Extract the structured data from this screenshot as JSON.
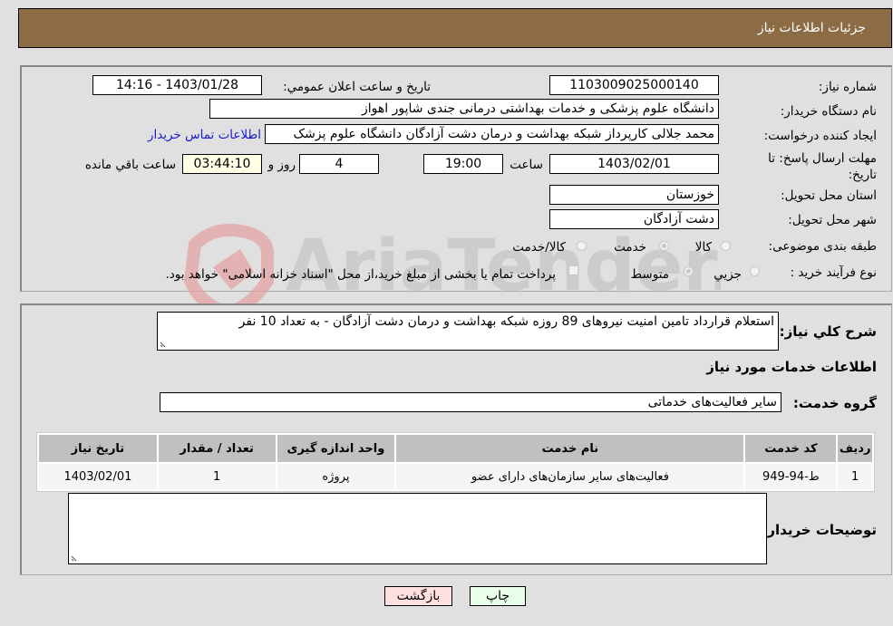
{
  "header": {
    "title": "جزئیات اطلاعات نیاز"
  },
  "form": {
    "need_number": {
      "label": "شماره نیاز:",
      "value": "1103009025000140"
    },
    "announce_datetime": {
      "label": "تاریخ و ساعت اعلان عمومي:",
      "value": "1403/01/28 - 14:16"
    },
    "buyer_org": {
      "label": "نام دستگاه خریدار:",
      "value": "دانشگاه علوم پزشکی و خدمات بهداشتی درمانی جندی شاپور اهواز"
    },
    "requester": {
      "label": "ایجاد کننده درخواست:",
      "value": "محمد جلالی کارپرداز شبکه بهداشت و درمان دشت آزادگان دانشگاه علوم پزشک",
      "contact_link": "اطلاعات تماس خریدار"
    },
    "deadline": {
      "label": "مهلت ارسال پاسخ: تا تاریخ:",
      "date": "1403/02/01",
      "time_label": "ساعت",
      "time": "19:00",
      "days": "4",
      "days_label": "روز و",
      "remaining": "03:44:10",
      "remaining_label": "ساعت باقي مانده"
    },
    "province": {
      "label": "استان محل تحویل:",
      "value": "خوزستان"
    },
    "city": {
      "label": "شهر محل تحویل:",
      "value": "دشت آزادگان"
    },
    "category": {
      "label": "طبقه بندی موضوعی:",
      "options": [
        "کالا",
        "خدمت",
        "کالا/خدمت"
      ],
      "selected": "خدمت"
    },
    "purchase_type": {
      "label": "نوع فرآیند خرید :",
      "options": [
        "جزيي",
        "متوسط"
      ],
      "selected": "متوسط",
      "treasury_note": "پرداخت تمام یا بخشی از مبلغ خرید،از محل \"اسناد خزانه اسلامی\" خواهد بود."
    }
  },
  "details": {
    "description_label": "شرح کلي نياز:",
    "description": "استعلام قرارداد تامین امنیت نیروهای 89 روزه  شبکه بهداشت و درمان دشت آزادگان   - به تعداد 10 نفر",
    "services_heading": "اطلاعات خدمات مورد نياز",
    "service_group_label": "گروه خدمت:",
    "service_group": "سایر فعالیت‌های خدماتی",
    "table": {
      "headers": [
        "ردیف",
        "کد خدمت",
        "نام خدمت",
        "واحد اندازه گیری",
        "تعداد / مقدار",
        "تاریخ نیاز"
      ],
      "rows": [
        [
          "1",
          "ط-94-949",
          "فعالیت‌های سایر سازمان‌های دارای عضو",
          "پروژه",
          "1",
          "1403/02/01"
        ]
      ]
    },
    "buyer_notes_label": "توضیحات خریدار:",
    "buyer_notes": ""
  },
  "buttons": {
    "print": "چاپ",
    "back": "بازگشت"
  },
  "watermark": {
    "text": "AriaTender.neT"
  },
  "colors": {
    "header_bg": "#8c6c44",
    "link": "#1a1acc",
    "print_bg": "#eaffea",
    "back_bg": "#ffe0e0"
  }
}
